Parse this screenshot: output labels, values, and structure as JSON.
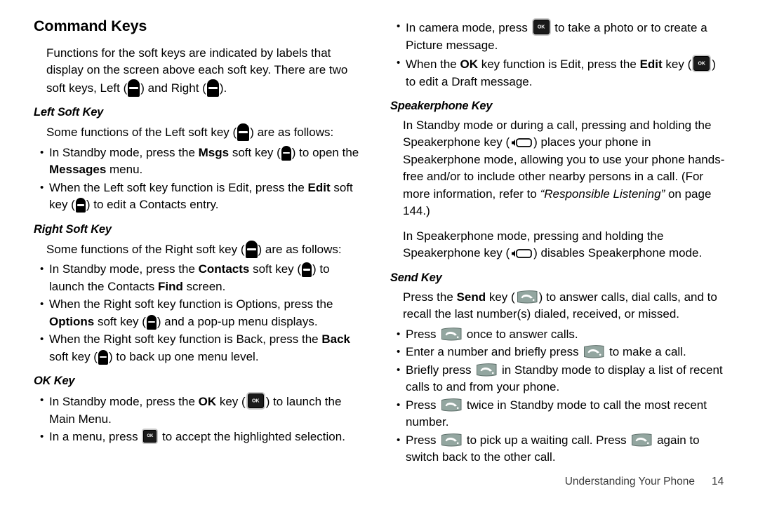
{
  "page": {
    "chapter_heading": "Command Keys",
    "footer_chapter": "Understanding Your Phone",
    "footer_page": "14"
  },
  "icons": {
    "soft_key": "soft-key-icon",
    "ok_key": "ok-key-icon",
    "ok_key_label": "OK",
    "speakerphone_key": "speakerphone-key-icon",
    "send_key": "send-key-icon"
  },
  "left_column": {
    "intro": {
      "t1": "Functions for the soft keys are indicated by labels that display on the screen above each soft key. There are two soft keys, Left (",
      "t2": ") and Right (",
      "t3": ")."
    },
    "sections": [
      {
        "heading": "Left Soft Key",
        "lead": {
          "t1": "Some functions of the Left soft key (",
          "t2": ") are as follows:"
        },
        "bullets": [
          {
            "t1": "In Standby mode, press the ",
            "b1": "Msgs",
            "t2": " soft key (",
            "t3": ") to open the ",
            "b2": "Messages",
            "t4": " menu."
          },
          {
            "t1": "When the Left soft key function is Edit, press the ",
            "b1": "Edit",
            "t2": " soft key (",
            "t3": ") to edit a Contacts entry."
          }
        ]
      },
      {
        "heading": "Right Soft Key",
        "lead": {
          "t1": "Some functions of the Right soft key (",
          "t2": ") are as follows:"
        },
        "bullets": [
          {
            "t1": "In Standby mode, press the ",
            "b1": "Contacts",
            "t2": " soft key (",
            "t3": ") to launch the Contacts ",
            "b2": "Find",
            "t4": " screen."
          },
          {
            "t1": "When the Right soft key function is Options, press the ",
            "b1": "Options",
            "t2": " soft key (",
            "t3": ") and a pop-up menu displays."
          },
          {
            "t1": "When the Right soft key function is Back, press the ",
            "b1": "Back",
            "t2": " soft key (",
            "t3": ") to back up one menu level."
          }
        ]
      },
      {
        "heading": "OK Key",
        "bullets": [
          {
            "t1": "In Standby mode, press the ",
            "b1": "OK",
            "t2": " key (",
            "t3": ") to launch the Main Menu."
          },
          {
            "t1": "In a menu, press ",
            "t2": " to accept the highlighted selection."
          }
        ]
      }
    ]
  },
  "right_column": {
    "ok_bullets": [
      {
        "t1": "In camera mode, press ",
        "t2": " to take a photo or to create a Picture message."
      },
      {
        "t1": "When the ",
        "b1": "OK",
        "t2": " key function is Edit, press the ",
        "b2": "Edit",
        "t3": " key (",
        "t4": ") to edit a Draft message."
      }
    ],
    "speakerphone": {
      "heading": "Speakerphone Key",
      "p1": {
        "t1": "In Standby mode or during a call, pressing and holding the Speakerphone key (",
        "t2": ") places your phone in Speakerphone mode, allowing you to use your phone hands-free and/or to include other nearby persons in a call. (For more information, refer to ",
        "ref": "“Responsible Listening”",
        "t3": " on page 144.)"
      },
      "p2": {
        "t1": "In Speakerphone mode, pressing and holding the Speakerphone key (",
        "t2": ") disables Speakerphone mode."
      }
    },
    "send": {
      "heading": "Send Key",
      "lead": {
        "t1": "Press the ",
        "b1": "Send",
        "t2": " key (",
        "t3": ") to answer calls, dial calls, and to recall the last number(s) dialed, received, or missed."
      },
      "bullets": [
        {
          "t1": "Press ",
          "t2": " once to answer calls."
        },
        {
          "t1": "Enter a number and briefly press ",
          "t2": " to make a call."
        },
        {
          "t1": "Briefly press ",
          "t2": " in Standby mode to display a list of recent calls to and from your phone."
        },
        {
          "t1": "Press ",
          "t2": " twice in Standby mode to call the most recent number."
        },
        {
          "t1": "Press ",
          "t2": " to pick up a waiting call. Press ",
          "t3": " again to switch back to the other call."
        }
      ]
    }
  }
}
